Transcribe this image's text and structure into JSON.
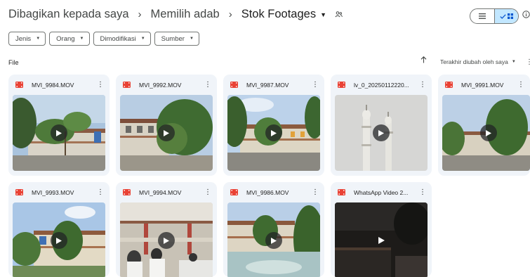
{
  "breadcrumb": {
    "items": [
      "Dibagikan kepada saya",
      "Memilih adab",
      "Stok Footages"
    ]
  },
  "filters": [
    "Jenis",
    "Orang",
    "Dimodifikasi",
    "Sumber"
  ],
  "list_header": {
    "section_label": "File",
    "sort_label": "Terakhir diubah oleh saya"
  },
  "icons": {
    "separator": "chevron-right-icon",
    "share": "shared-folder-icon",
    "video": "video-file-icon",
    "more": "more-vert-icon",
    "play": "play-icon"
  },
  "colors": {
    "accent": "#c2e7ff",
    "video_icon": "#e94235",
    "card_bg": "#f0f4f9"
  },
  "files": [
    {
      "name": "MVI_9984.MOV"
    },
    {
      "name": "MVI_9992.MOV"
    },
    {
      "name": "MVI_9987.MOV"
    },
    {
      "name": "lv_0_20250112220..."
    },
    {
      "name": "MVI_9991.MOV"
    },
    {
      "name": "MVI_9993.MOV"
    },
    {
      "name": "MVI_9994.MOV"
    },
    {
      "name": "MVI_9986.MOV"
    },
    {
      "name": "WhatsApp Video 2..."
    }
  ]
}
